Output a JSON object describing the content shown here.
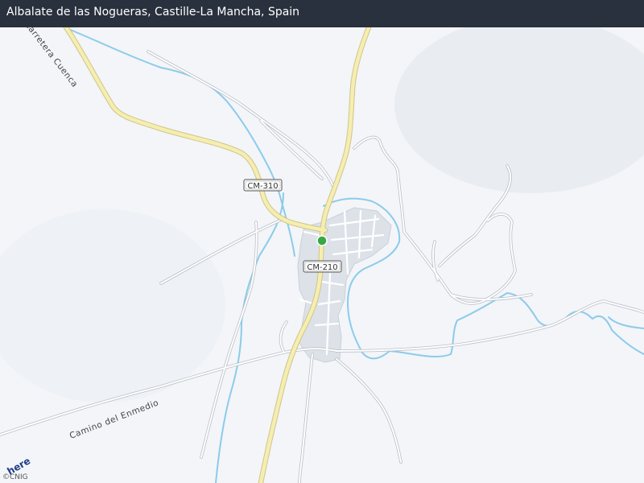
{
  "header": {
    "location_title": "Albalate de las Nogueras, Castille-La Mancha, Spain"
  },
  "map": {
    "road_labels": [
      {
        "id": "cm310",
        "text": "CM-310"
      },
      {
        "id": "cm210",
        "text": "CM-210"
      }
    ],
    "street_labels": {
      "carretera_cuenca": "Carretera Cuenca",
      "camino_enmedio": "Camino del Enmedio"
    },
    "marker": {
      "color": "#3aa645"
    },
    "colors": {
      "background": "#f3f5f8",
      "water": "#8ccbeb",
      "major_road": "#f5eeb0",
      "major_road_casing": "#cfc58a",
      "minor_road": "#ffffff",
      "minor_road_casing": "#b9bec6",
      "urban_area": "#dce1e8"
    }
  },
  "footer": {
    "logo_text": "here",
    "attribution": "©CNIG"
  }
}
